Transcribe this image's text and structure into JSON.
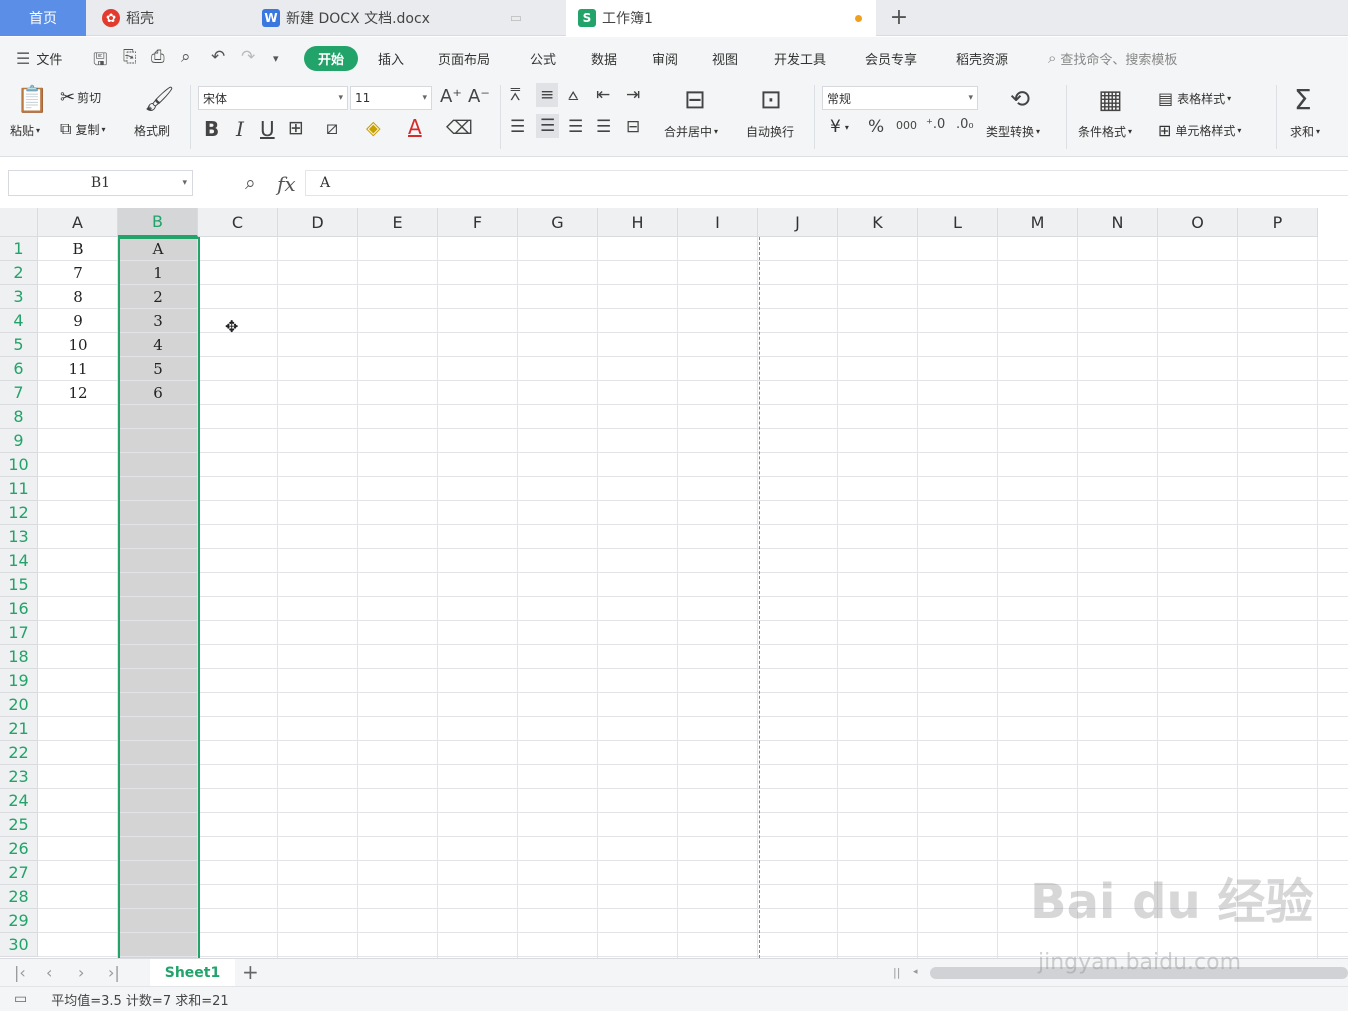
{
  "tabs": {
    "home": "首页",
    "daoke": "稻壳",
    "doc": "新建 DOCX 文档.docx",
    "sheet": "工作簿1",
    "new_tab": "+"
  },
  "menu": {
    "file": "文件",
    "start": "开始",
    "insert": "插入",
    "page_layout": "页面布局",
    "formula": "公式",
    "data": "数据",
    "review": "审阅",
    "view": "视图",
    "dev_tools": "开发工具",
    "member": "会员专享",
    "resources": "稻壳资源",
    "search": "查找命令、搜索模板"
  },
  "ribbon": {
    "paste": "粘贴",
    "cut": "剪切",
    "copy": "复制",
    "format_painter": "格式刷",
    "font": "宋体",
    "font_size": "11",
    "bold": "B",
    "italic": "I",
    "underline": "U",
    "font_color": "A",
    "merge_center": "合并居中",
    "auto_wrap": "自动换行",
    "number_format": "常规",
    "currency": "¥",
    "percent": "%",
    "thousands": "000",
    "type_convert": "类型转换",
    "cond_format": "条件格式",
    "table_style": "表格样式",
    "cell_style": "单元格样式",
    "sum": "求和"
  },
  "formula_bar": {
    "name_box": "B1",
    "fx": "fx",
    "content": "A"
  },
  "columns": [
    "A",
    "B",
    "C",
    "D",
    "E",
    "F",
    "G",
    "H",
    "I",
    "J",
    "K",
    "L",
    "M",
    "N",
    "O",
    "P"
  ],
  "rows": [
    "1",
    "2",
    "3",
    "4",
    "5",
    "6",
    "7",
    "8",
    "9",
    "10",
    "11",
    "12",
    "13",
    "14",
    "15",
    "16",
    "17",
    "18",
    "19",
    "20",
    "21",
    "22",
    "23",
    "24",
    "25",
    "26",
    "27",
    "28",
    "29",
    "30"
  ],
  "cells": {
    "A": [
      "B",
      "7",
      "8",
      "9",
      "10",
      "11",
      "12"
    ],
    "B": [
      "A",
      "1",
      "2",
      "3",
      "4",
      "5",
      "6"
    ]
  },
  "sheet_tab": "Sheet1",
  "status": "平均值=3.5  计数=7  求和=21",
  "watermark": {
    "logo": "Bai du 经验",
    "url": "jingyan.baidu.com"
  },
  "accent_color": "#22a36a"
}
